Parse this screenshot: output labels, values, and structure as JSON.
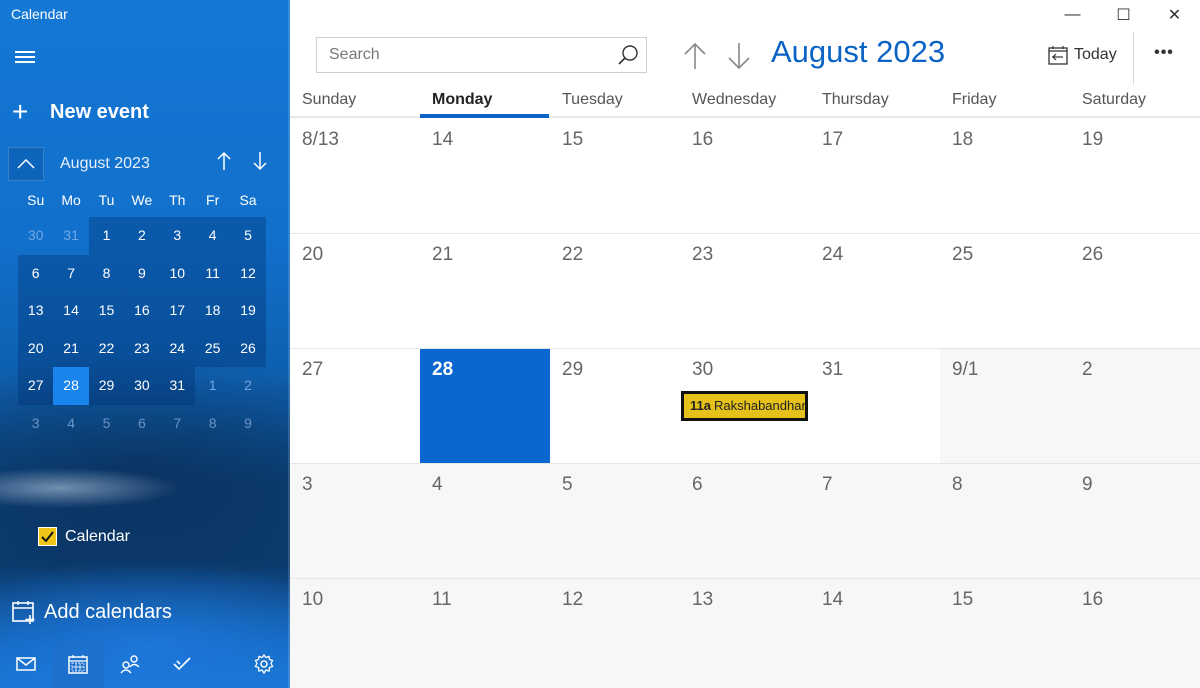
{
  "app": {
    "title": "Calendar"
  },
  "sidebar": {
    "new_event_label": "New event",
    "mini_calendar": {
      "title": "August 2023",
      "weekdays": [
        "Su",
        "Mo",
        "Tu",
        "We",
        "Th",
        "Fr",
        "Sa"
      ],
      "weeks": [
        [
          "30",
          "31",
          "1",
          "2",
          "3",
          "4",
          "5"
        ],
        [
          "6",
          "7",
          "8",
          "9",
          "10",
          "11",
          "12"
        ],
        [
          "13",
          "14",
          "15",
          "16",
          "17",
          "18",
          "19"
        ],
        [
          "20",
          "21",
          "22",
          "23",
          "24",
          "25",
          "26"
        ],
        [
          "27",
          "28",
          "29",
          "30",
          "31",
          "1",
          "2"
        ],
        [
          "3",
          "4",
          "5",
          "6",
          "7",
          "8",
          "9"
        ]
      ],
      "selected_day": "28"
    },
    "calendars": [
      {
        "label": "Calendar",
        "checked": true,
        "color": "#f0c419"
      }
    ],
    "add_calendars_label": "Add calendars",
    "bottom_nav": [
      {
        "name": "mail",
        "icon": "mail-icon"
      },
      {
        "name": "calendar",
        "icon": "calendar-icon",
        "active": true
      },
      {
        "name": "people",
        "icon": "people-icon"
      },
      {
        "name": "todo",
        "icon": "checkmark-icon"
      },
      {
        "name": "settings",
        "icon": "gear-icon"
      }
    ]
  },
  "toolbar": {
    "search_placeholder": "Search",
    "month_title": "August 2023",
    "today_label": "Today",
    "more_label": "•••"
  },
  "window_controls": {
    "minimize": "—",
    "maximize": "☐",
    "close": "✕"
  },
  "month_view": {
    "weekdays": [
      "Sunday",
      "Monday",
      "Tuesday",
      "Wednesday",
      "Thursday",
      "Friday",
      "Saturday"
    ],
    "selected_weekday": "Monday",
    "weeks": [
      [
        "8/13",
        "14",
        "15",
        "16",
        "17",
        "18",
        "19"
      ],
      [
        "20",
        "21",
        "22",
        "23",
        "24",
        "25",
        "26"
      ],
      [
        "27",
        "28",
        "29",
        "30",
        "31",
        "9/1",
        "2"
      ],
      [
        "3",
        "4",
        "5",
        "6",
        "7",
        "8",
        "9"
      ],
      [
        "10",
        "11",
        "12",
        "13",
        "14",
        "15",
        "16"
      ]
    ],
    "today": "28",
    "events": [
      {
        "day": "30",
        "time": "11a",
        "title": "Rakshabandhan",
        "color": "#e6c11a"
      }
    ]
  }
}
